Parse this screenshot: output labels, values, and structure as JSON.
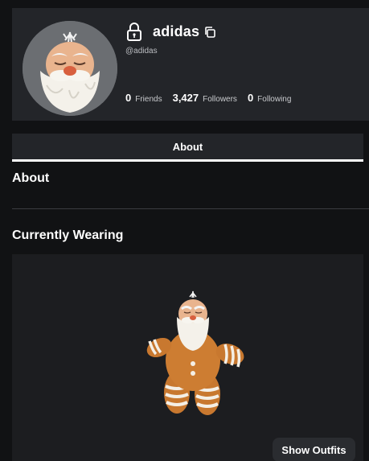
{
  "profile": {
    "display_name": "adidas",
    "username": "@adidas",
    "stats": [
      {
        "value": "0",
        "label": "Friends"
      },
      {
        "value": "3,427",
        "label": "Followers"
      },
      {
        "value": "0",
        "label": "Following"
      }
    ],
    "icons": [
      "lock-icon",
      "copy-icon"
    ]
  },
  "tabs": [
    {
      "label": "About",
      "active": true
    }
  ],
  "about": {
    "title": "About"
  },
  "wearing": {
    "title": "Currently Wearing",
    "show_outfits_label": "Show Outfits"
  },
  "colors": {
    "background": "#111214",
    "card": "#232529",
    "panel": "#1c1d20",
    "active_tab_underline": "#ffffff",
    "gingerbread": "#c8782f"
  }
}
